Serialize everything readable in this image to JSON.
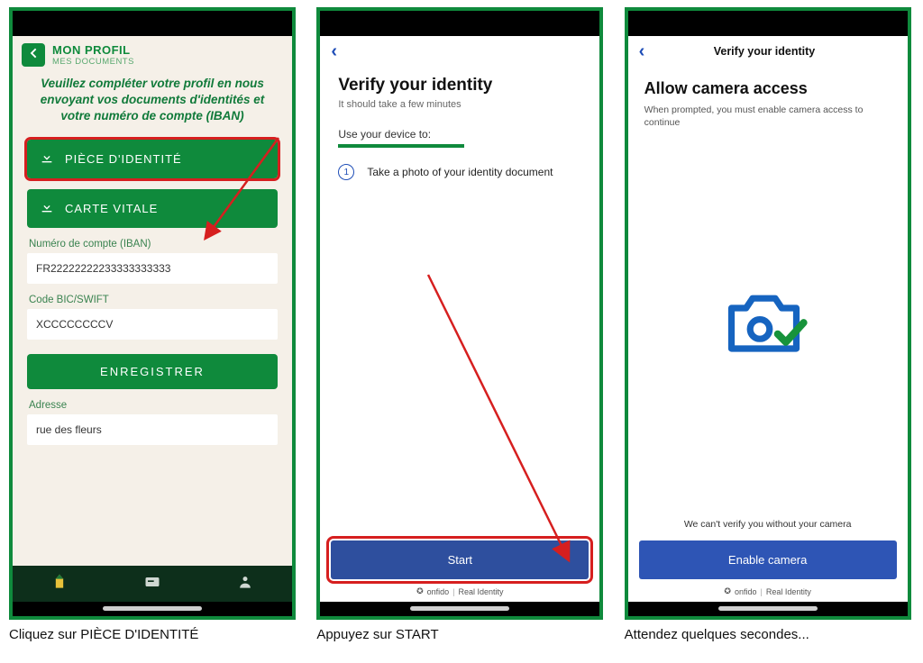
{
  "screen1": {
    "title": "MON PROFIL",
    "subtitle": "MES DOCUMENTS",
    "intro": "Veuillez compléter votre profil en nous envoyant vos documents d'identités et votre numéro de compte (IBAN)",
    "btn_identity": "PIÈCE D'IDENTITÉ",
    "btn_vitale": "CARTE VITALE",
    "iban_label": "Numéro de compte (IBAN)",
    "iban_value": "FR22222222233333333333",
    "bic_label": "Code BIC/SWIFT",
    "bic_value": "XCCCCCCCCV",
    "save": "ENREGISTRER",
    "address_label": "Adresse",
    "address_value": "rue des fleurs",
    "caption": "Cliquez sur PIÈCE D'IDENTITÉ"
  },
  "screen2": {
    "heading": "Verify your identity",
    "subheading": "It should take a few minutes",
    "use_device": "Use your device to:",
    "step1": "Take a photo of your identity document",
    "step1_num": "1",
    "start": "Start",
    "onfido_brand": "onfido",
    "onfido_tag": "Real Identity",
    "caption": "Appuyez sur START"
  },
  "screen3": {
    "top_title": "Verify your identity",
    "heading": "Allow camera access",
    "subheading": "When prompted, you must enable camera access to continue",
    "note": "We can't verify you without your camera",
    "enable": "Enable camera",
    "onfido_brand": "onfido",
    "onfido_tag": "Real Identity",
    "caption": "Attendez quelques secondes..."
  }
}
